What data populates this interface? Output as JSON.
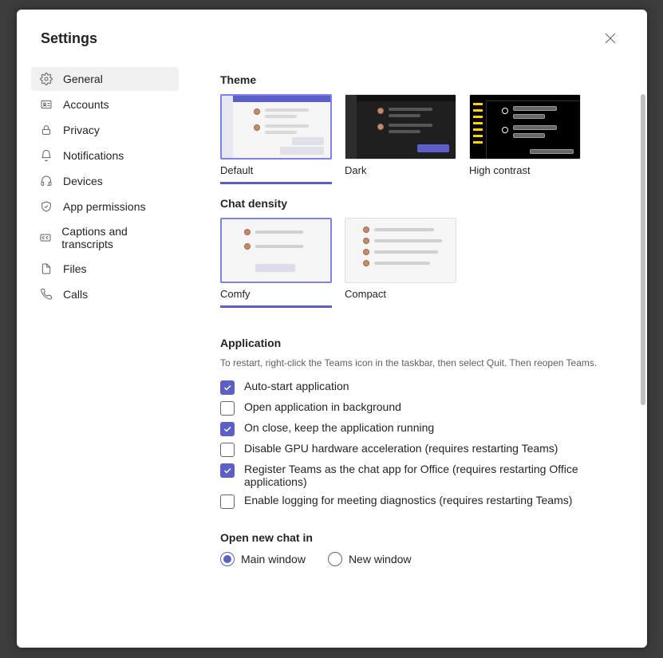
{
  "title": "Settings",
  "sidebar": {
    "items": [
      {
        "label": "General",
        "icon": "gear-icon",
        "selected": true
      },
      {
        "label": "Accounts",
        "icon": "id-card-icon",
        "selected": false
      },
      {
        "label": "Privacy",
        "icon": "lock-icon",
        "selected": false
      },
      {
        "label": "Notifications",
        "icon": "bell-icon",
        "selected": false
      },
      {
        "label": "Devices",
        "icon": "headset-icon",
        "selected": false
      },
      {
        "label": "App permissions",
        "icon": "shield-icon",
        "selected": false
      },
      {
        "label": "Captions and transcripts",
        "icon": "cc-icon",
        "selected": false
      },
      {
        "label": "Files",
        "icon": "file-icon",
        "selected": false
      },
      {
        "label": "Calls",
        "icon": "phone-icon",
        "selected": false
      }
    ]
  },
  "theme": {
    "heading": "Theme",
    "options": [
      {
        "label": "Default",
        "variant": "default",
        "selected": true
      },
      {
        "label": "Dark",
        "variant": "dark",
        "selected": false
      },
      {
        "label": "High contrast",
        "variant": "high",
        "selected": false
      }
    ]
  },
  "density": {
    "heading": "Chat density",
    "options": [
      {
        "label": "Comfy",
        "variant": "comfy",
        "selected": true
      },
      {
        "label": "Compact",
        "variant": "compact",
        "selected": false
      }
    ]
  },
  "application": {
    "heading": "Application",
    "hint": "To restart, right-click the Teams icon in the taskbar, then select Quit. Then reopen Teams.",
    "options": [
      {
        "label": "Auto-start application",
        "checked": true
      },
      {
        "label": "Open application in background",
        "checked": false
      },
      {
        "label": "On close, keep the application running",
        "checked": true
      },
      {
        "label": "Disable GPU hardware acceleration (requires restarting Teams)",
        "checked": false
      },
      {
        "label": "Register Teams as the chat app for Office (requires restarting Office applications)",
        "checked": true
      },
      {
        "label": "Enable logging for meeting diagnostics (requires restarting Teams)",
        "checked": false
      }
    ]
  },
  "openChat": {
    "heading": "Open new chat in",
    "options": [
      {
        "label": "Main window",
        "checked": true
      },
      {
        "label": "New window",
        "checked": false
      }
    ]
  }
}
